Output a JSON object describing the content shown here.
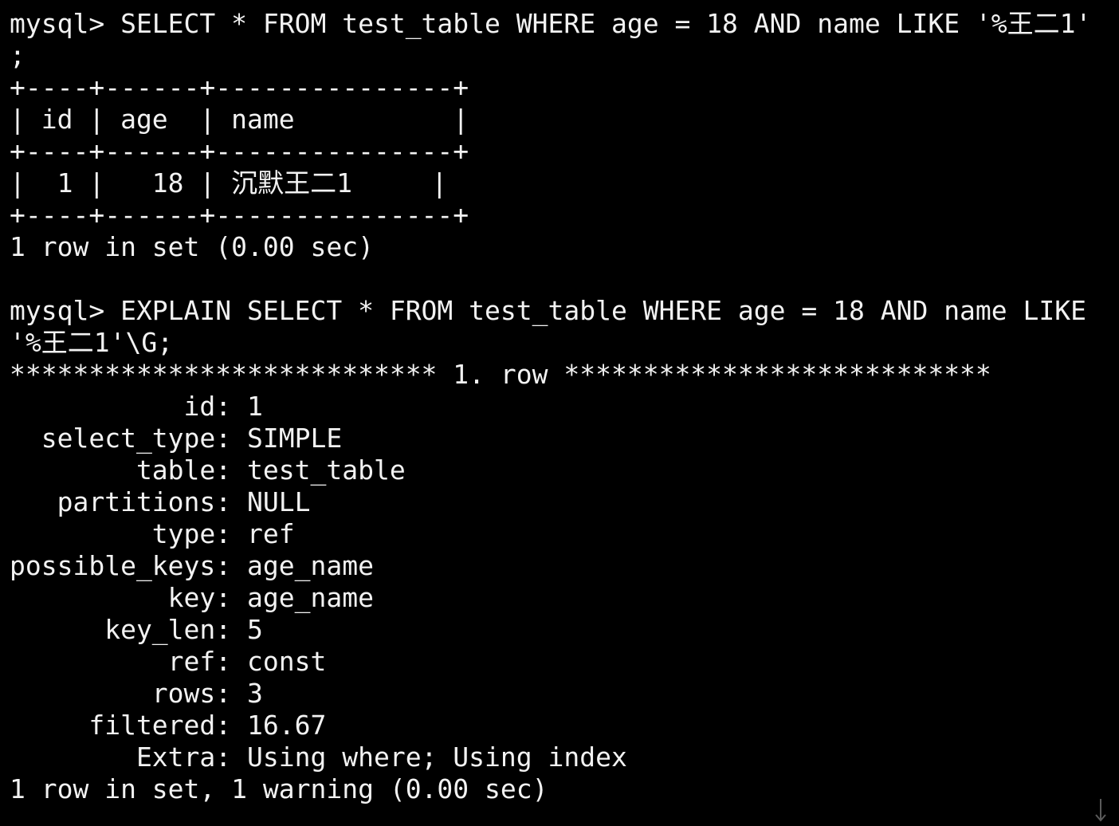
{
  "terminal": {
    "lines": [
      "mysql> SELECT * FROM test_table WHERE age = 18 AND name LIKE '%王二1'",
      ";",
      "+----+------+---------------+",
      "| id | age  | name          |",
      "+----+------+---------------+",
      "|  1 |   18 | 沉默王二1     |",
      "+----+------+---------------+",
      "1 row in set (0.00 sec)",
      "",
      "mysql> EXPLAIN SELECT * FROM test_table WHERE age = 18 AND name LIKE",
      "'%王二1'\\G;",
      "*************************** 1. row ***************************",
      "           id: 1",
      "  select_type: SIMPLE",
      "        table: test_table",
      "   partitions: NULL",
      "         type: ref",
      "possible_keys: age_name",
      "          key: age_name",
      "      key_len: 5",
      "          ref: const",
      "         rows: 3",
      "     filtered: 16.67",
      "        Extra: Using where; Using index",
      "1 row in set, 1 warning (0.00 sec)"
    ],
    "text_color": "#f2f2f2",
    "background_color": "#000000",
    "scroll_icon": "down-arrow-icon"
  }
}
